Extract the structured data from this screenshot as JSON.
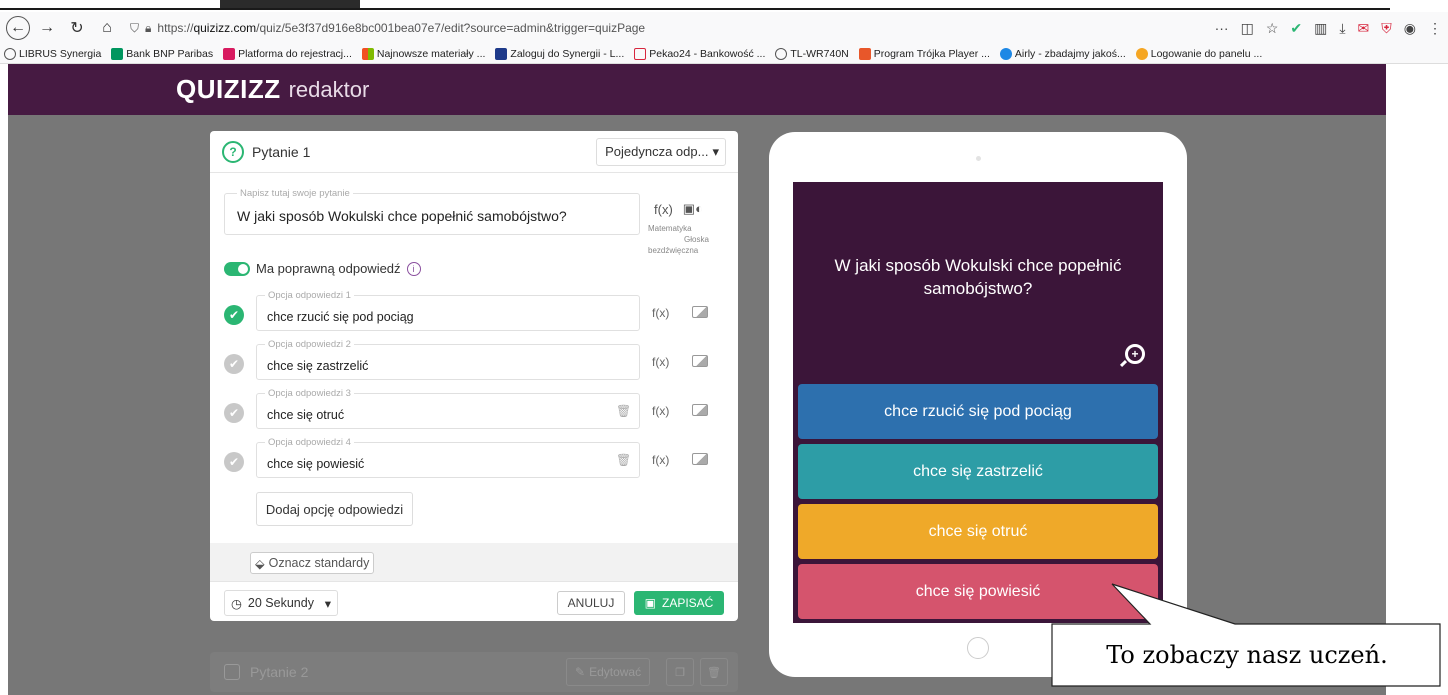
{
  "browser": {
    "url_prefix": "https://",
    "url_domain": "quizizz.com",
    "url_path": "/quiz/5e3f37d916e8bc001bea07e7/edit?source=admin&trigger=quizPage",
    "toolbar_more": "···",
    "bookmarks": [
      {
        "label": "LIBRUS Synergia",
        "color": "#555555"
      },
      {
        "label": "Bank BNP Paribas",
        "color": "#00965e"
      },
      {
        "label": "Platforma do rejestracj...",
        "color": "#d81b60"
      },
      {
        "label": "Najnowsze materiały ...",
        "color": "#f25022"
      },
      {
        "label": "Zaloguj do Synergii - L...",
        "color": "#1e3a8a"
      },
      {
        "label": "Pekao24 - Bankowość ...",
        "color": "#d7263d"
      },
      {
        "label": "TL-WR740N",
        "color": "#555555"
      },
      {
        "label": "Program Trójka Player ...",
        "color": "#e8572a"
      },
      {
        "label": "Airly - zbadajmy jakoś...",
        "color": "#1e88e5"
      },
      {
        "label": "Logowanie do panelu ...",
        "color": "#f5a623"
      }
    ]
  },
  "header": {
    "logo": "QUIZIZZ",
    "subtitle": "redaktor"
  },
  "editor": {
    "title": "Pytanie 1",
    "type_select": "Pojedyncza odp...",
    "question_placeholder": "Napisz tutaj swoje pytanie",
    "question_text": "W jaki sposób Wokulski chce popełnić samobójstwo?",
    "math_symbol": "f(x)",
    "tool_label_1": "Matematyka",
    "tool_label_2": "Głoska bezdźwięczna",
    "toggle_label": "Ma poprawną odpowiedź",
    "options": [
      {
        "placeholder": "Opcja odpowiedzi 1",
        "value": "chce rzucić się pod pociąg",
        "correct": true
      },
      {
        "placeholder": "Opcja odpowiedzi 2",
        "value": "chce się zastrzelić",
        "correct": false
      },
      {
        "placeholder": "Opcja odpowiedzi 3",
        "value": "chce się otruć",
        "correct": false
      },
      {
        "placeholder": "Opcja odpowiedzi 4",
        "value": "chce się powiesić",
        "correct": false
      }
    ],
    "add_option": "Dodaj opcję odpowiedzi",
    "standards": "Oznacz standardy",
    "time": "20 Sekundy",
    "cancel": "ANULUJ",
    "save": "ZAPISAĆ"
  },
  "question2": {
    "title": "Pytanie 2",
    "edit": "Edytować"
  },
  "preview": {
    "question": "W jaki sposób Wokulski chce popełnić samobójstwo?",
    "answers": [
      {
        "text": "chce rzucić się pod pociąg",
        "color": "#2d70ae"
      },
      {
        "text": "chce się zastrzelić",
        "color": "#2d9da6"
      },
      {
        "text": "chce się otruć",
        "color": "#efa929"
      },
      {
        "text": "chce się powiesić",
        "color": "#d5546d"
      }
    ]
  },
  "callout": {
    "text": "To zobaczy nasz uczeń."
  },
  "colors": {
    "purple": "#461a42",
    "green": "#2bb673",
    "work_bg": "#777777"
  }
}
